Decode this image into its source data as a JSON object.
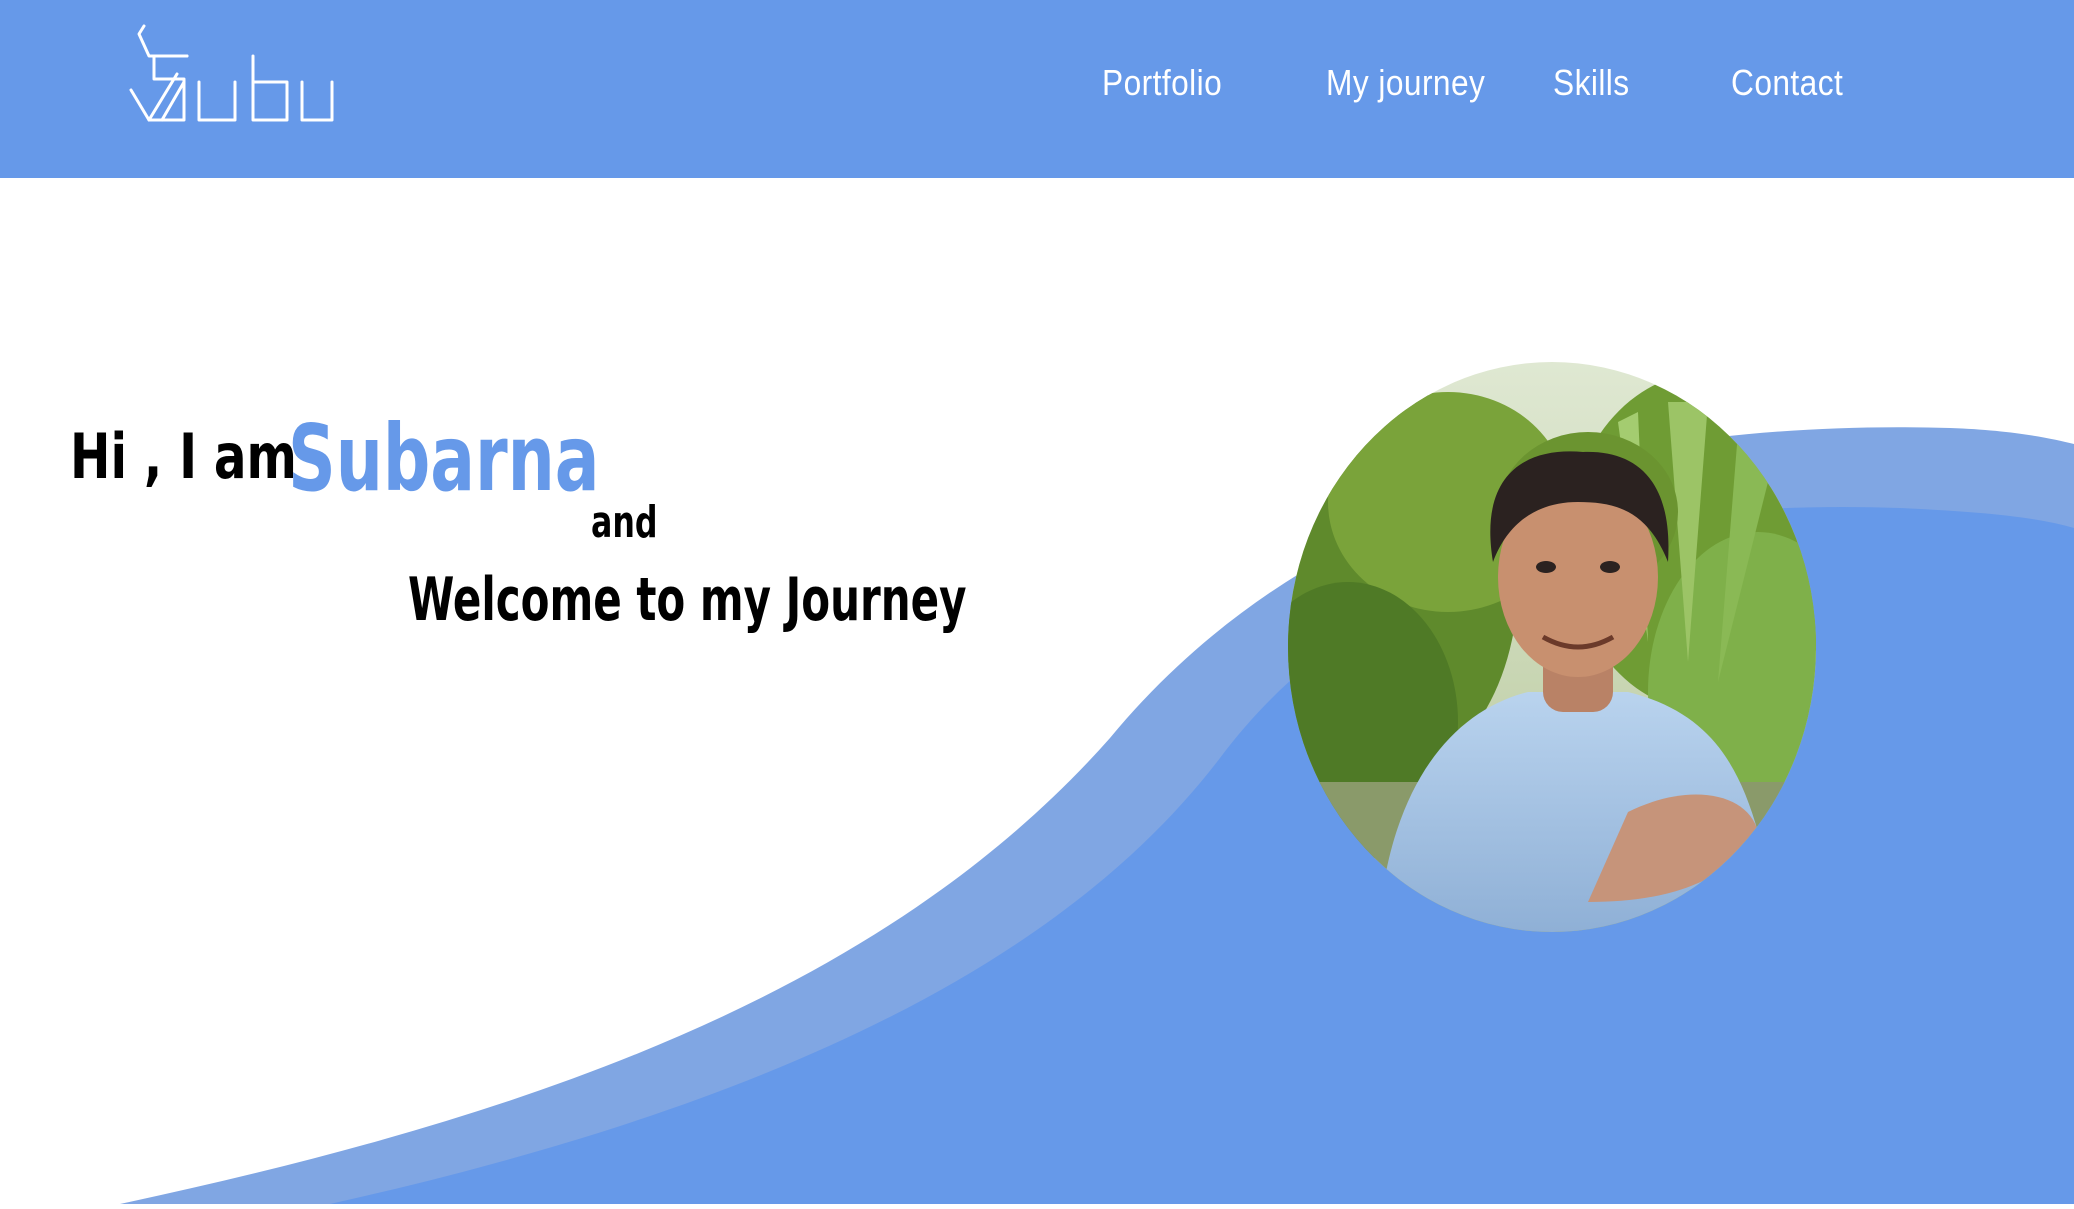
{
  "header": {
    "logo_text": "Subu",
    "nav": [
      {
        "label": "Portfolio"
      },
      {
        "label": "My journey"
      },
      {
        "label": "Skills"
      },
      {
        "label": "Contact"
      }
    ]
  },
  "hero": {
    "greeting": "Hi , I am",
    "name": "Subarna",
    "connector": "and",
    "welcome": "Welcome to my Journey"
  },
  "colors": {
    "brand": "#6699e9",
    "wave_light": "#80a6e3"
  },
  "icons": {
    "logo": "subu-logo-icon"
  }
}
